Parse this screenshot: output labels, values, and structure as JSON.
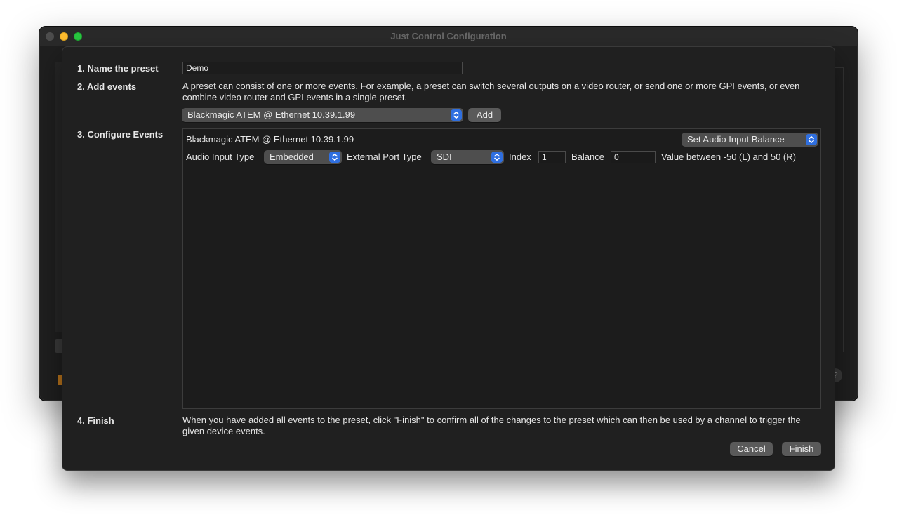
{
  "window": {
    "title": "Just Control Configuration",
    "help_symbol": "?"
  },
  "steps": {
    "name_label": "1. Name the preset",
    "add_label": "2. Add events",
    "configure_label": "3. Configure Events",
    "finish_label": "4. Finish"
  },
  "preset": {
    "name_value": "Demo"
  },
  "add_events": {
    "description": "A preset can consist of one or more events. For example, a preset can switch several outputs on a video router, or send one or more GPI events, or even combine video router and GPI events in a single preset.",
    "device_selected": "Blackmagic ATEM @ Ethernet 10.39.1.99",
    "add_button": "Add"
  },
  "event": {
    "device_name": "Blackmagic ATEM @ Ethernet 10.39.1.99",
    "action_selected": "Set Audio Input Balance",
    "audio_input_type_label": "Audio Input Type",
    "audio_input_type_value": "Embedded",
    "external_port_type_label": "External Port Type",
    "external_port_type_value": "SDI",
    "index_label": "Index",
    "index_value": "1",
    "balance_label": "Balance",
    "balance_value": "0",
    "balance_hint": "Value between -50 (L) and 50 (R)"
  },
  "finish": {
    "description": "When you have added all events to the preset, click \"Finish\" to confirm all of the changes to the preset which can then be used by a channel to trigger the given device events.",
    "cancel_button": "Cancel",
    "finish_button": "Finish"
  },
  "colors": {
    "accent": "#2f6fe0",
    "sheet_bg": "#202020",
    "text": "#e6e6e6"
  }
}
